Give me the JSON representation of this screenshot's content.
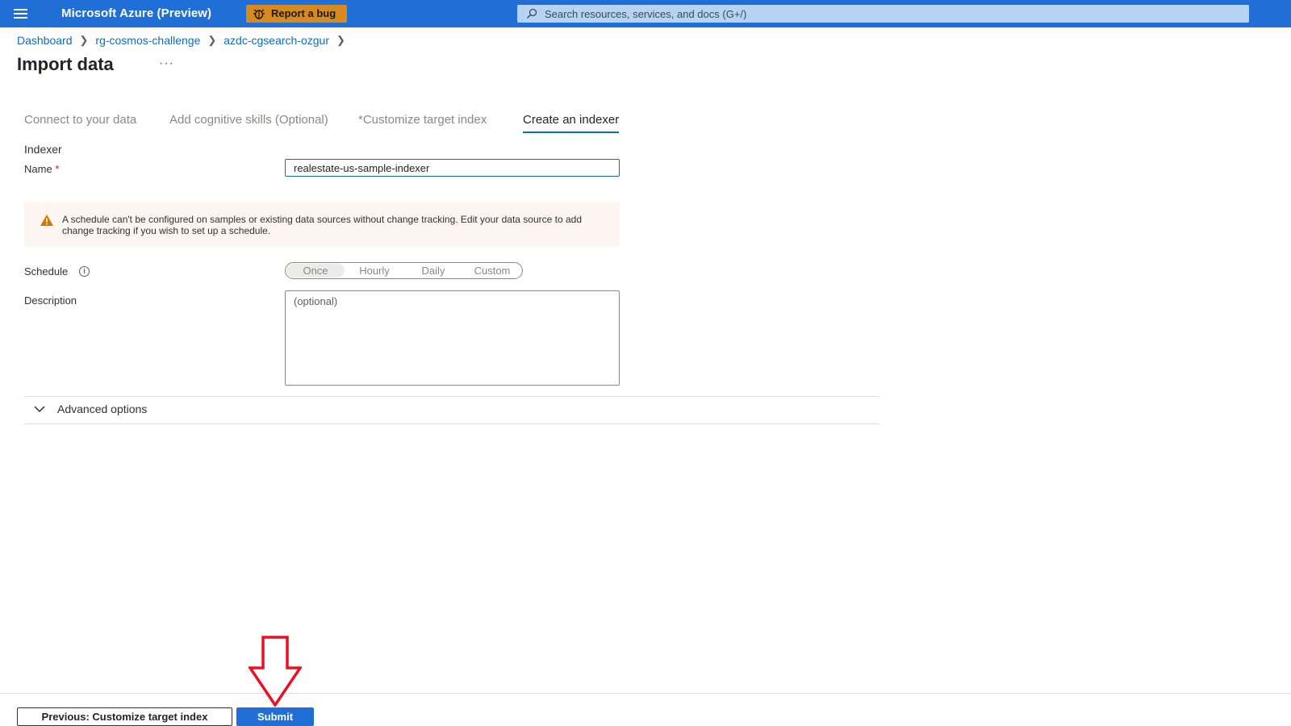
{
  "topbar": {
    "brand": "Microsoft Azure (Preview)",
    "bug_button": "Report a bug",
    "search_placeholder": "Search resources, services, and docs (G+/)",
    "bg_color": "#1f6fd6",
    "bug_color": "#d98a1e"
  },
  "breadcrumb": {
    "items": [
      "Dashboard",
      "rg-cosmos-challenge",
      "azdc-cgsearch-ozgur"
    ]
  },
  "page": {
    "title": "Import data",
    "more": "···"
  },
  "tabs": [
    {
      "label": "Connect to your data",
      "active": false
    },
    {
      "label": "Add cognitive skills (Optional)",
      "active": false
    },
    {
      "label": "*Customize target index",
      "active": false
    },
    {
      "label": "Create an indexer",
      "active": true
    }
  ],
  "form": {
    "section": "Indexer",
    "name_label": "Name",
    "required_mark": "*",
    "name_value": "realestate-us-sample-indexer",
    "warning": "A schedule can't be configured on samples or existing data sources without change tracking. Edit your data source to add change tracking if you wish to set up a schedule.",
    "schedule_label": "Schedule",
    "schedule_info_icon": "i",
    "schedule_options": [
      "Once",
      "Hourly",
      "Daily",
      "Custom"
    ],
    "schedule_selected": "Once",
    "description_label": "Description",
    "description_placeholder": "(optional)",
    "advanced": "Advanced options"
  },
  "footer": {
    "previous": "Previous: Customize target index",
    "submit": "Submit"
  },
  "annotation": {
    "arrow_color": "#e81123",
    "icon": "down-arrow-icon"
  }
}
